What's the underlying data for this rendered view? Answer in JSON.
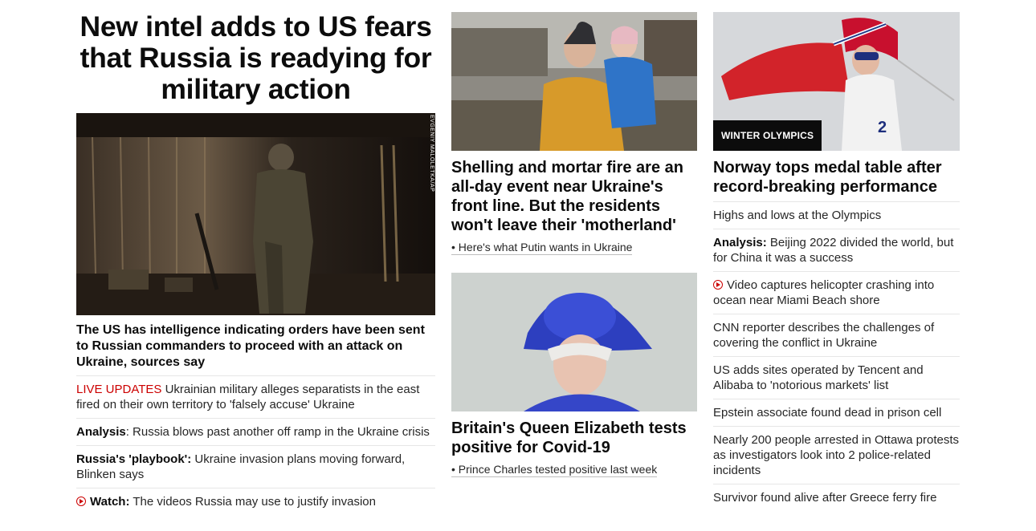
{
  "lead": {
    "headline": "New intel adds to US fears that Russia is readying for military action",
    "image_credit": "EVGENIY MALOLETKA/AP",
    "subheadline": "The US has intelligence indicating orders have been sent to Russian commanders to proceed with an attack on Ukraine, sources say",
    "items": [
      {
        "prefix": "LIVE UPDATES",
        "text": " Ukrainian military alleges separatists in the east fired on their own territory to 'falsely accuse' Ukraine"
      },
      {
        "prefix": "Analysis",
        "text": ": Russia blows past another off ramp in the Ukraine crisis"
      },
      {
        "prefix": "Russia's 'playbook':",
        "text": " Ukraine invasion plans moving forward, Blinken says"
      },
      {
        "prefix": "Watch:",
        "text": " The videos Russia may use to justify invasion",
        "icon": "play-icon"
      }
    ]
  },
  "middle": {
    "story1": {
      "headline": "Shelling and mortar fire are an all-day event near Ukraine's front line. But the residents won't leave their 'motherland'",
      "link": "• Here's what Putin wants in Ukraine"
    },
    "story2": {
      "headline": "Britain's Queen Elizabeth tests positive for Covid-19",
      "link": "• Prince Charles tested positive last week"
    }
  },
  "right": {
    "kicker": "WINTER OLYMPICS",
    "headline": "Norway tops medal table after record-breaking performance",
    "items": [
      {
        "prefix": "",
        "text": "Highs and lows at the Olympics"
      },
      {
        "prefix": "Analysis:",
        "text": " Beijing 2022 divided the world, but for China it was a success"
      },
      {
        "prefix": "",
        "text": "Video captures helicopter crashing into ocean near Miami Beach shore",
        "icon": "play-icon"
      },
      {
        "prefix": "",
        "text": "CNN reporter describes the challenges of covering the conflict in Ukraine"
      },
      {
        "prefix": "",
        "text": "US adds sites operated by Tencent and Alibaba to 'notorious markets' list"
      },
      {
        "prefix": "",
        "text": "Epstein associate found dead in prison cell"
      },
      {
        "prefix": "",
        "text": "Nearly 200 people arrested in Ottawa protests as investigators look into 2 police-related incidents"
      },
      {
        "prefix": "",
        "text": "Survivor found alive after Greece ferry fire"
      }
    ]
  },
  "colors": {
    "accent_red": "#cc0000",
    "text": "#0c0c0c",
    "divider": "#e6e6e6"
  }
}
